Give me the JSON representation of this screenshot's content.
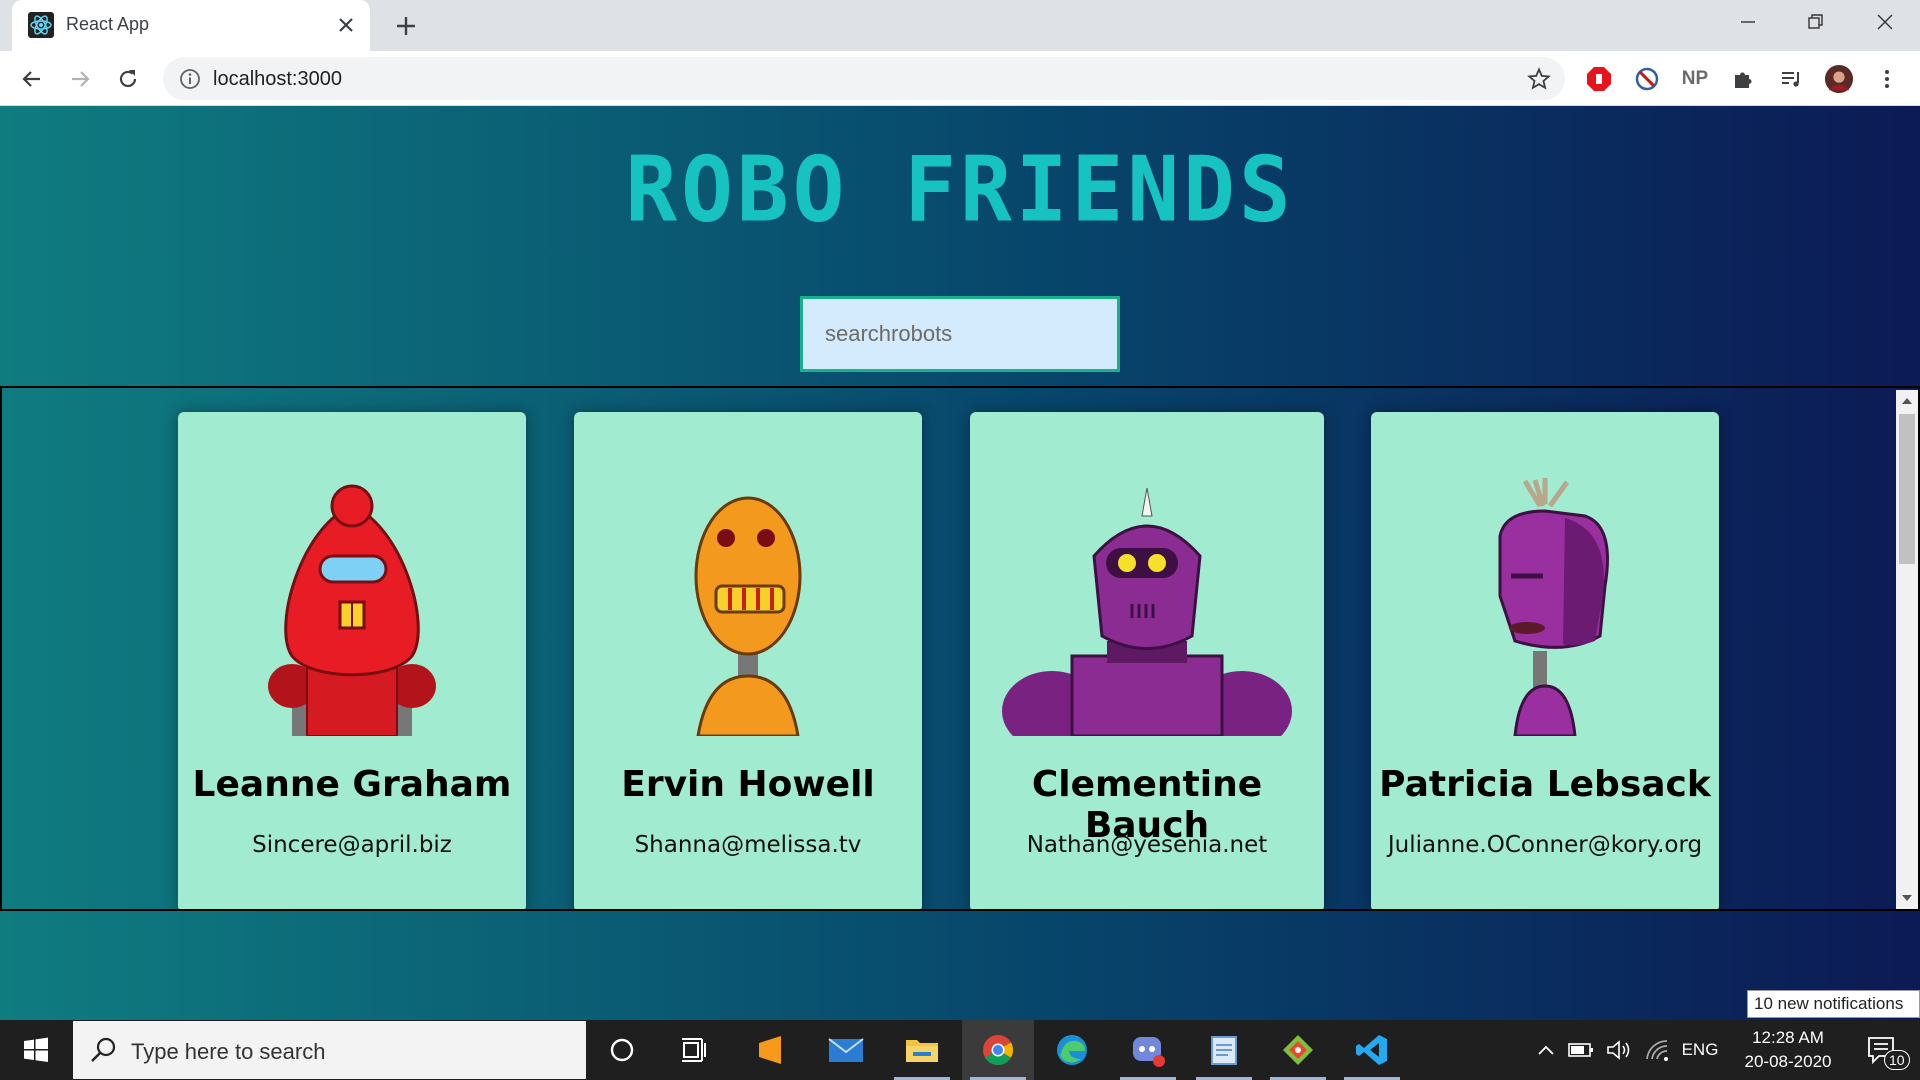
{
  "browser": {
    "tab_title": "React App",
    "url": "localhost:3000"
  },
  "app": {
    "title": "ROBO FRIENDS",
    "search_placeholder": "searchrobots"
  },
  "robots": [
    {
      "name": "Leanne Graham",
      "email": "Sincere@april.biz",
      "color": "#e81c24"
    },
    {
      "name": "Ervin Howell",
      "email": "Shanna@melissa.tv",
      "color": "#f39a1e"
    },
    {
      "name": "Clementine Bauch",
      "email": "Nathan@yesenia.net",
      "color": "#8b2c92"
    },
    {
      "name": "Patricia Lebsack",
      "email": "Julianne.OConner@kory.org",
      "color": "#9a2fa0"
    }
  ],
  "notification_toast": "10 new notifications",
  "taskbar": {
    "search_placeholder": "Type here to search",
    "language": "ENG",
    "time": "12:28 AM",
    "date": "20-08-2020",
    "notification_count": "10"
  },
  "extensions": {
    "np_label": "NP"
  },
  "colors": {
    "title": "#17c3c0",
    "card_bg": "#a1ebd0",
    "search_bg": "#d3ebfc",
    "search_border": "#17b18a"
  }
}
